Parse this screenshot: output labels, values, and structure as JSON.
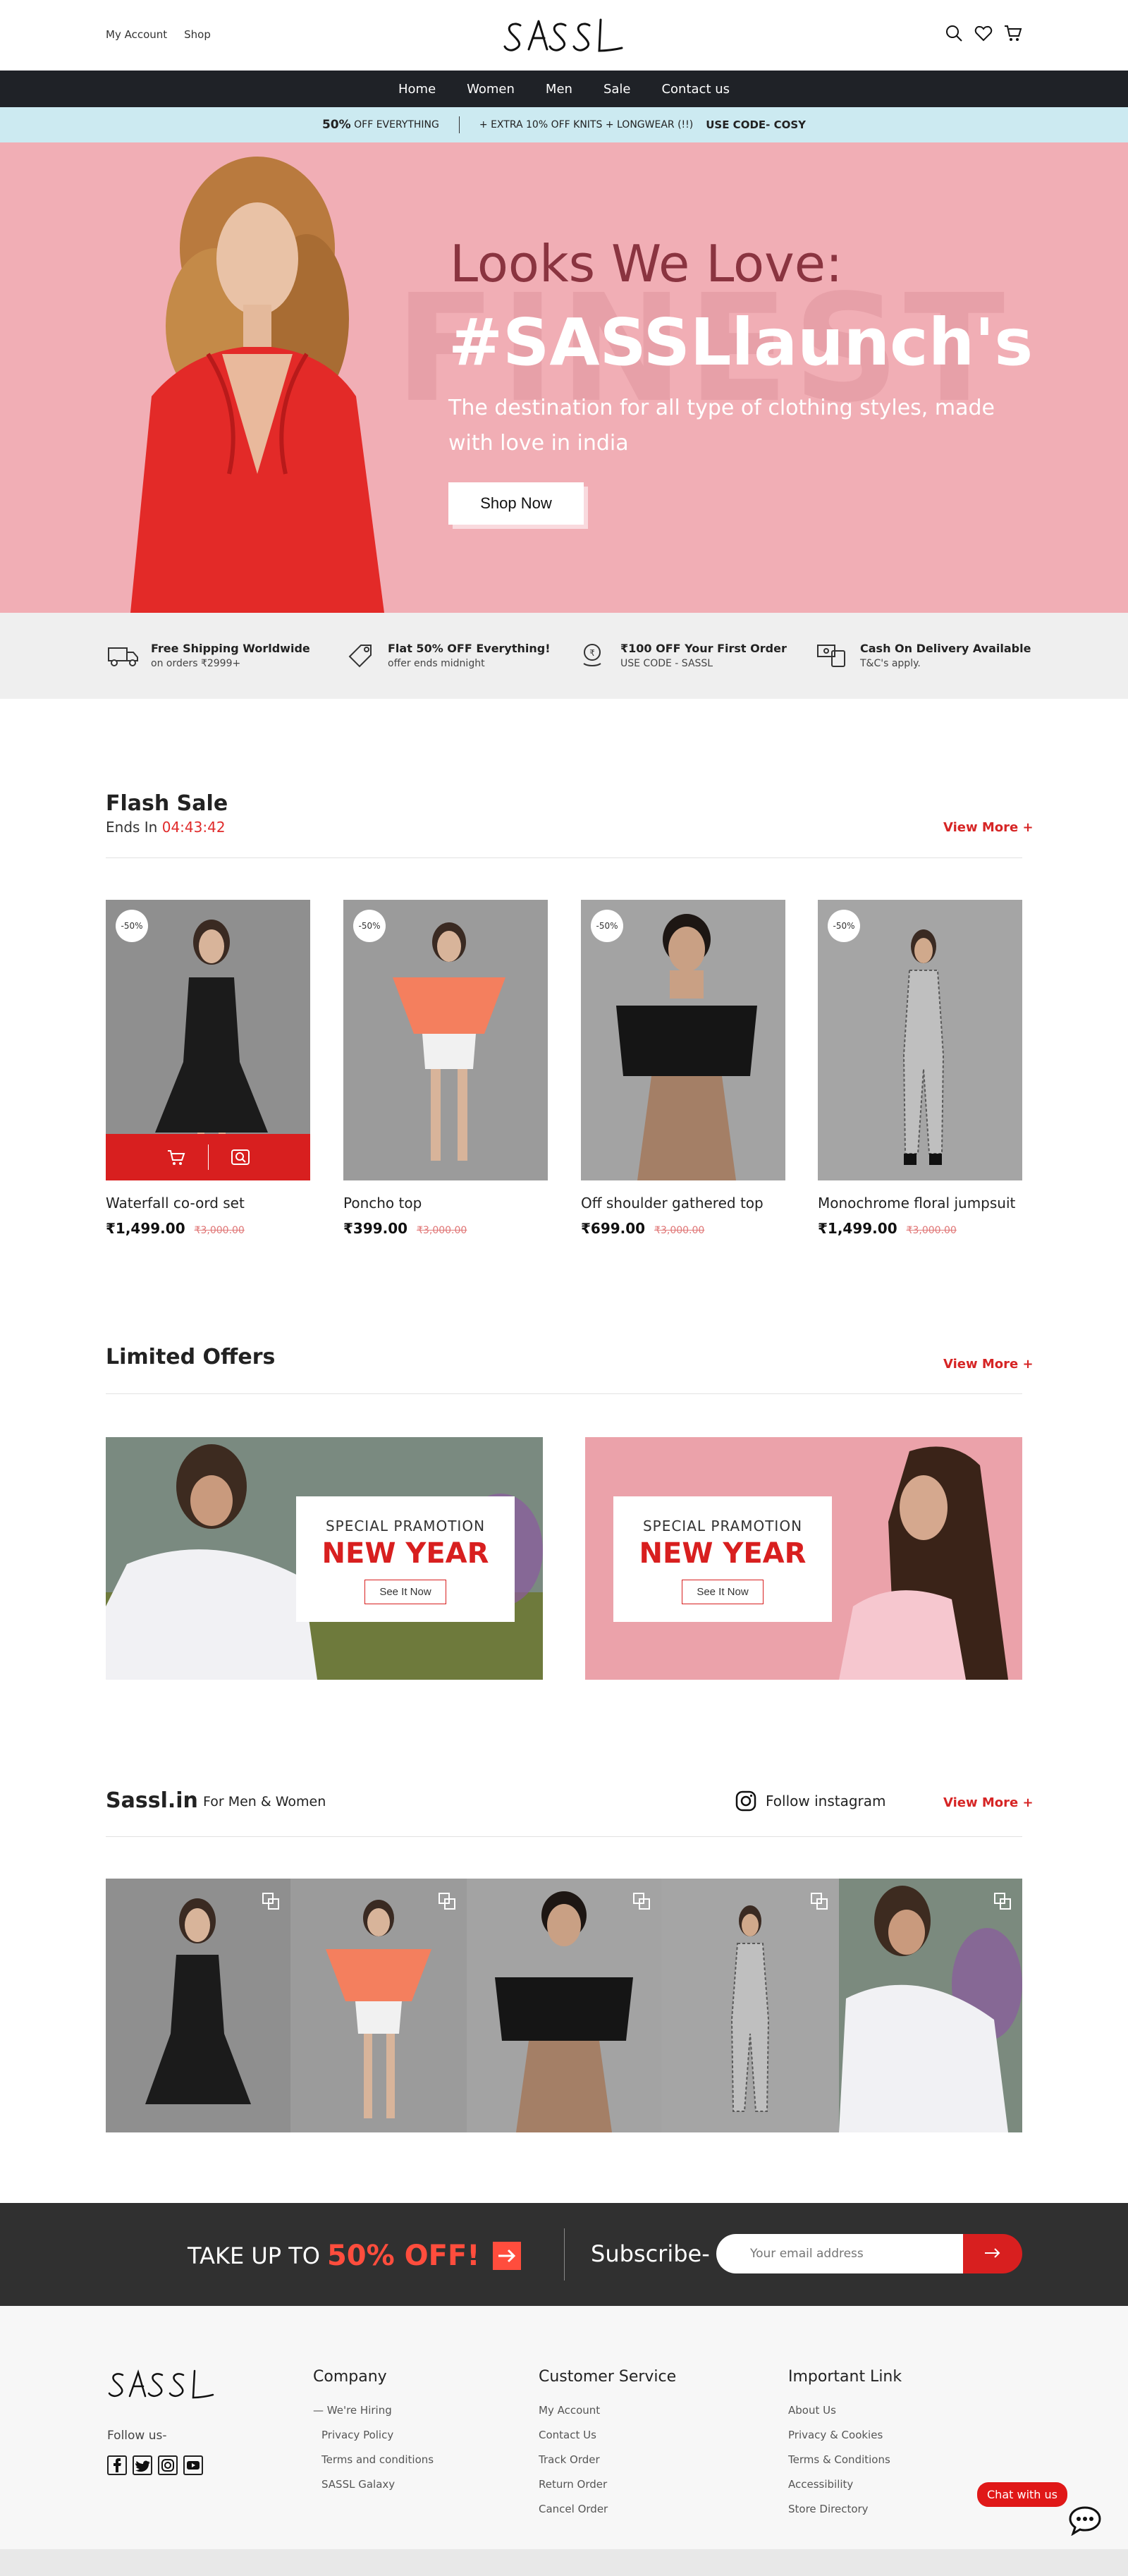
{
  "header": {
    "links": [
      "My Account",
      "Shop"
    ],
    "logo_text": "SASSL"
  },
  "nav": {
    "items": [
      "Home",
      "Women",
      "Men",
      "Sale",
      "Contact us"
    ]
  },
  "promo": {
    "highlight": "50%",
    "left_text": "OFF EVERYTHING",
    "middle_text": "+ EXTRA 10% OFF KNITS + LONGWEAR (!!)",
    "code_text": "USE CODE- COSY"
  },
  "hero": {
    "watermark": "FINEST",
    "subtitle": "Looks We Love:",
    "title": "#SASSLlaunch's",
    "description": "The destination for all type of clothing styles, made with love in india",
    "button": "Shop Now"
  },
  "features": [
    {
      "title": "Free Shipping Worldwide",
      "sub": "on orders ₹2999+",
      "icon": "truck-icon"
    },
    {
      "title": "Flat 50% OFF Everything!",
      "sub": "offer ends midnight",
      "icon": "tag-icon"
    },
    {
      "title": "₹100 OFF Your First Order",
      "sub": "USE CODE - SASSL",
      "icon": "coin-icon"
    },
    {
      "title": "Cash On Delivery Available",
      "sub": "T&C's apply.",
      "icon": "cash-icon"
    }
  ],
  "flash_sale": {
    "title": "Flash Sale",
    "ends_label": "Ends In",
    "timer": "04:43:42",
    "view_more": "View More  +",
    "products": [
      {
        "name": "Waterfall co-ord set",
        "price": "₹1,499.00",
        "old_price": "₹3,000.00",
        "badge": "-50%"
      },
      {
        "name": "Poncho top",
        "price": "₹399.00",
        "old_price": "₹3,000.00",
        "badge": "-50%"
      },
      {
        "name": "Off shoulder gathered top",
        "price": "₹699.00",
        "old_price": "₹3,000.00",
        "badge": "-50%"
      },
      {
        "name": "Monochrome floral jumpsuit",
        "price": "₹1,499.00",
        "old_price": "₹3,000.00",
        "badge": "-50%"
      }
    ]
  },
  "limited_offers": {
    "title": "Limited Offers",
    "view_more": "View More  +",
    "cards": [
      {
        "tag": "SPECIAL PRAMOTION",
        "headline": "NEW YEAR",
        "button": "See It Now"
      },
      {
        "tag": "SPECIAL PRAMOTION",
        "headline": "NEW YEAR",
        "button": "See It Now"
      }
    ]
  },
  "instagram": {
    "title": "Sassl.in",
    "subtitle": "For Men & Women",
    "follow": "Follow instagram",
    "view_more": "View More  +"
  },
  "subscribe": {
    "left_text": "TAKE UP TO",
    "left_highlight": "50% OFF!",
    "label": "Subscribe-",
    "placeholder": "Your email address"
  },
  "footer": {
    "logo_text": "SASSL",
    "follow": "Follow us-",
    "columns": [
      {
        "heading": "Company",
        "links": [
          "We're Hiring",
          "Privacy Policy",
          "Terms and conditions",
          "SASSL Galaxy"
        ]
      },
      {
        "heading": "Customer Service",
        "links": [
          "My Account",
          "Contact Us",
          "Track Order",
          "Return Order",
          "Cancel Order"
        ]
      },
      {
        "heading": "Important Link",
        "links": [
          "About Us",
          "Privacy & Cookies",
          "Terms & Conditions",
          "Accessibility",
          "Store Directory"
        ]
      }
    ],
    "chat": "Chat with us"
  },
  "colors": {
    "accent_red": "#d81f1f",
    "hero_pink": "#f1aeb5",
    "nav_dark": "#1f2227",
    "promo_blue": "#cceaf1"
  }
}
